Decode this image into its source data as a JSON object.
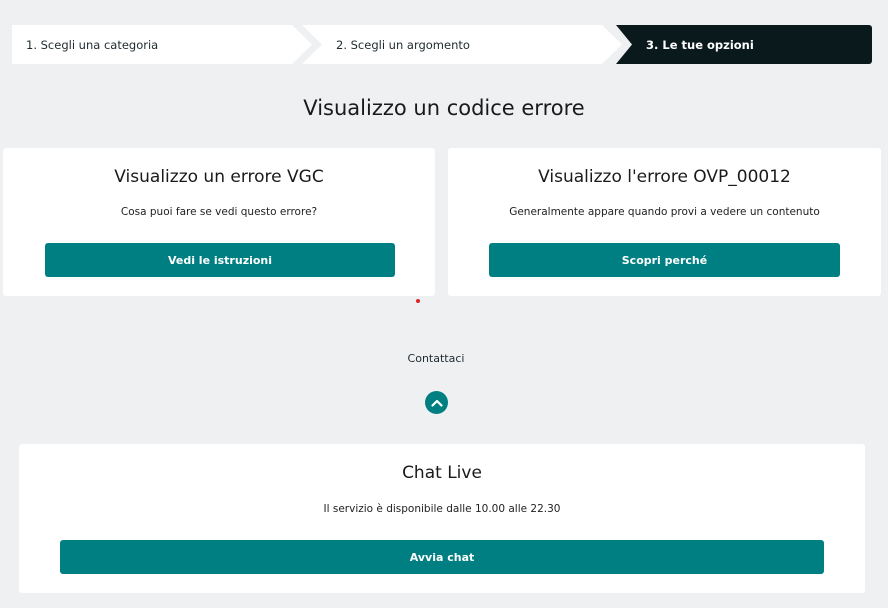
{
  "stepper": {
    "steps": [
      {
        "label": "1. Scegli una categoria"
      },
      {
        "label": "2. Scegli un argomento"
      },
      {
        "label": "3. Le tue opzioni"
      }
    ]
  },
  "page": {
    "title": "Visualizzo un codice errore"
  },
  "cards": [
    {
      "title": "Visualizzo un errore VGC",
      "description": "Cosa puoi fare se vedi questo errore?",
      "button_label": "Vedi le istruzioni"
    },
    {
      "title": "Visualizzo l'errore OVP_00012",
      "description": "Generalmente appare quando provi a vedere un contenuto",
      "button_label": "Scopri perché"
    }
  ],
  "contact": {
    "label": "Contattaci",
    "toggle_icon": "chevron-up-icon",
    "chat": {
      "title": "Chat Live",
      "description": "Il servizio è disponibile dalle 10.00 alle 22.30",
      "button_label": "Avvia chat"
    }
  },
  "colors": {
    "accent": "#007f82",
    "active_step": "#0a1a1c",
    "background": "#eef0f2"
  }
}
